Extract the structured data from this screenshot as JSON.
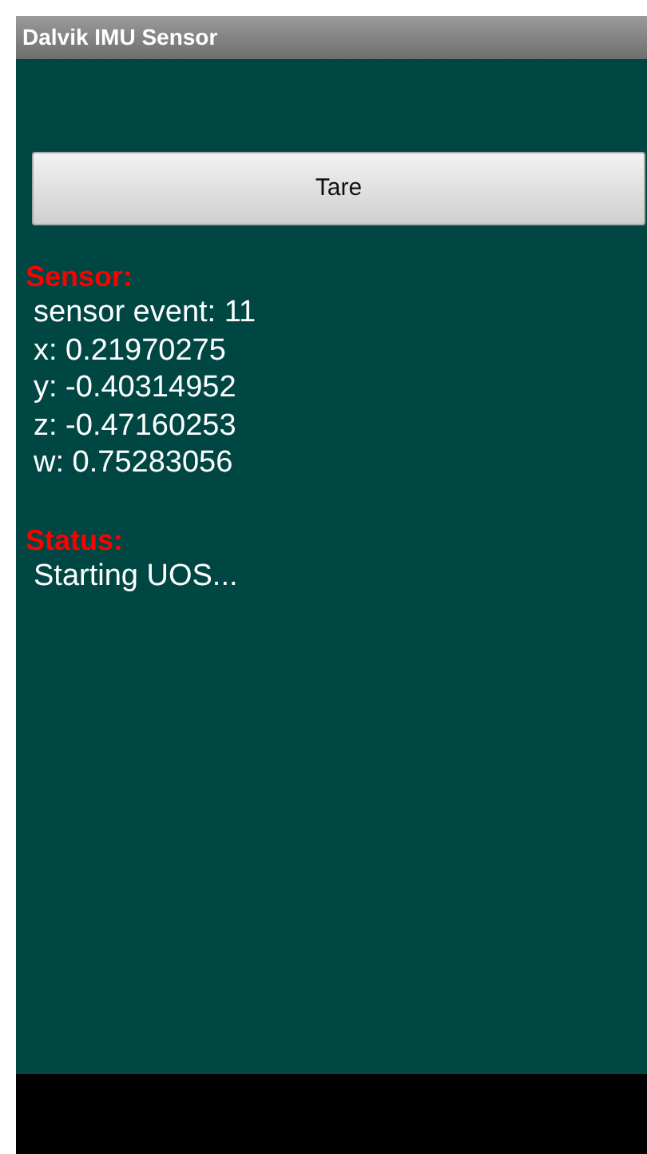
{
  "window": {
    "title": "Dalvik IMU Sensor"
  },
  "button": {
    "label": "Tare"
  },
  "sensor": {
    "heading": "Sensor:",
    "lines": [
      "sensor event: 11",
      "x: 0.21970275",
      "y: -0.40314952",
      "z: -0.47160253",
      "w: 0.75283056"
    ]
  },
  "status": {
    "heading": "Status:",
    "lines": [
      "Starting UOS..."
    ]
  }
}
